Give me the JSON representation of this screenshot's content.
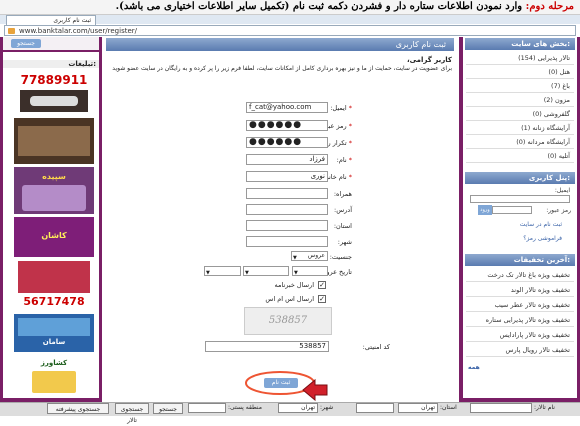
{
  "banner": {
    "step_label": "مرحله دوم:",
    "text": "وارد نمودن اطلاعات ستاره دار و فشردن دکمه ثبت نام (تکمیل سایر اطلاعات اختیاری می باشد)."
  },
  "browser": {
    "tab_title": "ثبت نام کاربری",
    "url": "www.banktalar.com/user/register/"
  },
  "top_search": {
    "button": "جستجو"
  },
  "left": {
    "ads_title": "تبلیغات:",
    "ads": [
      {
        "text": "77889911"
      },
      {
        "text": ""
      },
      {
        "text": "سپیده"
      },
      {
        "text": "کاشان"
      },
      {
        "text": "56717478"
      },
      {
        "text": "سامان"
      },
      {
        "text": "کشاورز"
      }
    ]
  },
  "center": {
    "title": "ثبت نام کاربری",
    "greeting": "کاربر گرامی،",
    "intro": "برای عضویت در سایت، حمایت از ما و نیز بهره برداری کامل از امکانات سایت، لطفا فرم زیر را پر کرده و به رایگان در سایت عضو شوید",
    "form": {
      "email_label": "ایمیل:",
      "email_value": "f_cat@yahoo.com",
      "password_label": "رمز عبور:",
      "password_value": "●●●●●●",
      "password_confirm_label": "تکرار رمز عبور:",
      "password_confirm_value": "●●●●●●",
      "name_label": "نام:",
      "name_value": "فرزاد",
      "family_label": "نام خانوادگی:",
      "family_value": "نوری",
      "mobile_label": "همراه:",
      "address_label": "آدرس:",
      "province_label": "استان:",
      "city_label": "شهر:",
      "gender_label": "جنسیت:",
      "gender_value": "عروس",
      "wedding_date_label": "تاریخ عروسی:",
      "newsletter_label": "ارسال خبرنامه",
      "sms_label": "ارسال اس ام اس",
      "captcha_text": "538857",
      "captcha_label": "کد امنیتی:",
      "captcha_value": "538857",
      "submit_label": "ثبت نام"
    }
  },
  "right": {
    "sections_title": "بخش های سایت:",
    "sections": [
      {
        "label": "تالار پذیرایی (154)"
      },
      {
        "label": "هتل (0)"
      },
      {
        "label": "باغ (7)"
      },
      {
        "label": "مزون (2)"
      },
      {
        "label": "گلفروشی (0)"
      },
      {
        "label": "آرایشگاه زنانه (1)"
      },
      {
        "label": "آرایشگاه مردانه (0)"
      },
      {
        "label": "آتلیه (0)"
      }
    ],
    "login_title": "پنل کاربری:",
    "login_email_label": "ایمیل:",
    "login_password_label": "رمز عبور:",
    "login_button": "ورود",
    "register_link": "ثبت نام در سایت",
    "forgot_link": "فراموشی رمز؟",
    "news_title": "آخرین تخفیفات:",
    "news": [
      {
        "label": "تخفیف ویژه باغ تالار تک درخت"
      },
      {
        "label": "تخفیف ویژه تالار الوند"
      },
      {
        "label": "تخفیف ویژه تالار عطر سیب"
      },
      {
        "label": "تخفیف ویژه تالار پذیرایی ستاره"
      },
      {
        "label": "تخفیف ویژه تالار پارادایس"
      },
      {
        "label": "تخفیف تالار رویال پارس"
      }
    ],
    "more_link": "همه"
  },
  "bottom": {
    "talar_name_label": "نام تالار:",
    "province_label": "استان:",
    "province_value": "تهران",
    "city_label": "شهر:",
    "city_value": "تهران",
    "area_label": "منطقه پستی:",
    "search_button": "جستجو",
    "quick_search_button": "جستجوی تالار",
    "advanced_search_button": "جستجوی پیشرفته"
  },
  "colors": {
    "accent": "#7a1f66",
    "header_blue": "#5a7bb0",
    "button_blue": "#7fa6d6"
  }
}
